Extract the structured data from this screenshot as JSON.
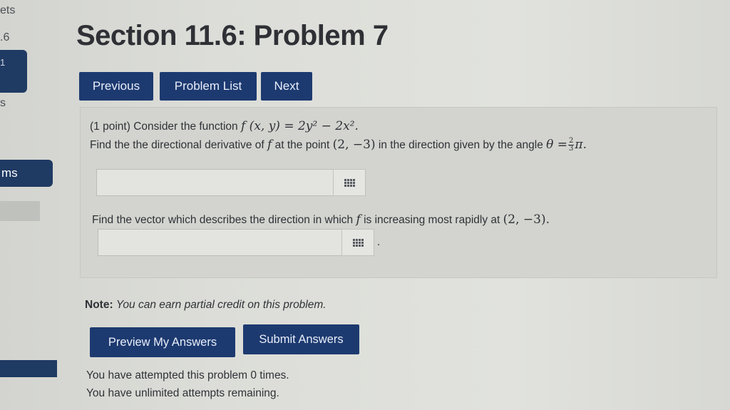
{
  "sidebar": {
    "fragment_1": "ets",
    "fragment_2": ".6",
    "fragment_3": "1",
    "fragment_4": "s",
    "fragment_5": "ms"
  },
  "page_title": "Section 11.6: Problem 7",
  "nav": {
    "previous_label": "Previous",
    "problem_list_label": "Problem List",
    "next_label": "Next"
  },
  "problem": {
    "points": "(1 point)",
    "intro": "Consider the function",
    "function": "f (x, y) = 2y² − 2x².",
    "q1_prefix": "Find the the directional derivative of",
    "q1_f": "f",
    "q1_mid": "at the point",
    "q1_point": "(2, −3)",
    "q1_suffix": "in the direction given by the angle",
    "theta": "θ =",
    "frac_num": "2",
    "frac_den": "3",
    "pi": "π.",
    "answer1_value": "",
    "q2_prefix": "Find the vector which describes the direction in which",
    "q2_f": "f",
    "q2_mid": "is increasing most rapidly at",
    "q2_point": "(2, −3).",
    "answer2_value": "",
    "answer2_period": "."
  },
  "note": {
    "label": "Note:",
    "text": "You can earn partial credit on this problem."
  },
  "actions": {
    "preview_label": "Preview My Answers",
    "submit_label": "Submit Answers"
  },
  "status": {
    "attempts_line": "You have attempted this problem 0 times.",
    "remaining_line": "You have unlimited attempts remaining."
  },
  "colors": {
    "button_bg": "#1d3a70",
    "button_text": "#e9eefa",
    "page_bg": "#dcddd8"
  },
  "icons": {
    "matrix_button": "matrix-grid-icon"
  }
}
